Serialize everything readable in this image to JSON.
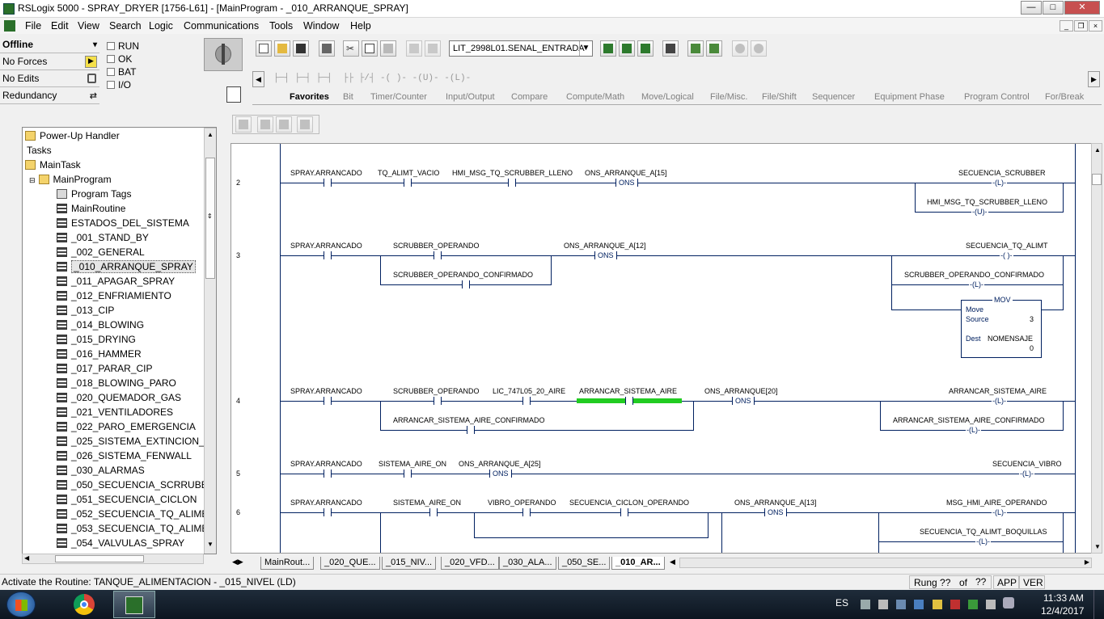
{
  "window": {
    "title": "RSLogix 5000 - SPRAY_DRYER [1756-L61] - [MainProgram - _010_ARRANQUE_SPRAY]"
  },
  "menu": [
    "File",
    "Edit",
    "View",
    "Search",
    "Logic",
    "Communications",
    "Tools",
    "Window",
    "Help"
  ],
  "status_panel": {
    "offline": "Offline",
    "no_forces": "No Forces",
    "no_edits": "No Edits",
    "redundancy": "Redundancy",
    "checks": [
      "RUN",
      "OK",
      "BAT",
      "I/O"
    ]
  },
  "toolbar": {
    "tag_dropdown": "LIT_2998L01.SENAL_ENTRADA"
  },
  "instruction_tabs": [
    "Favorites",
    "Bit",
    "Timer/Counter",
    "Input/Output",
    "Compare",
    "Compute/Math",
    "Move/Logical",
    "File/Misc.",
    "File/Shift",
    "Sequencer",
    "Equipment Phase",
    "Program Control",
    "For/Break"
  ],
  "tree": {
    "top": [
      {
        "label": "Power-Up Handler",
        "icon": "folder-icon"
      },
      {
        "label": "Tasks",
        "icon": ""
      },
      {
        "label": "MainTask",
        "icon": "folder-icon"
      },
      {
        "label": "MainProgram",
        "icon": "program-icon"
      },
      {
        "label": "Program Tags",
        "icon": "tags-icon"
      },
      {
        "label": "MainRoutine",
        "icon": "main-routine-icon"
      }
    ],
    "routines": [
      "ESTADOS_DEL_SISTEMA",
      "_001_STAND_BY",
      "_002_GENERAL",
      "_010_ARRANQUE_SPRAY",
      "_011_APAGAR_SPRAY",
      "_012_ENFRIAMIENTO",
      "_013_CIP",
      "_014_BLOWING",
      "_015_DRYING",
      "_016_HAMMER",
      "_017_PARAR_CIP",
      "_018_BLOWING_PARO",
      "_020_QUEMADOR_GAS",
      "_021_VENTILADORES",
      "_022_PARO_EMERGENCIA",
      "_025_SISTEMA_EXTINCION_FU",
      "_026_SISTEMA_FENWALL",
      "_030_ALARMAS",
      "_050_SECUENCIA_SCRRUBER",
      "_051_SECUENCIA_CICLON",
      "_052_SECUENCIA_TQ_ALIMEN",
      "_053_SECUENCIA_TQ_ALIMEN",
      "_054_VALVULAS_SPRAY"
    ]
  },
  "ladder": {
    "rungs": [
      "2",
      "3",
      "4",
      "5",
      "6"
    ],
    "r2": {
      "c1": "SPRAY.ARRANCADO",
      "c2": "TQ_ALIMT_VACIO",
      "c3": "HMI_MSG_TQ_SCRUBBER_LLENO",
      "c4": "ONS_ARRANQUE_A[15]",
      "ons": "ONS",
      "o1": "SECUENCIA_SCRUBBER",
      "o2": "HMI_MSG_TQ_SCRUBBER_LLENO",
      "coil1": "-(L)-",
      "coil2": "-(U)-"
    },
    "r3": {
      "c1": "SPRAY.ARRANCADO",
      "c2": "SCRUBBER_OPERANDO",
      "c2b": "SCRUBBER_OPERANDO_CONFIRMADO",
      "c3": "ONS_ARRANQUE_A[12]",
      "ons": "ONS",
      "o1": "SECUENCIA_TQ_ALIMT",
      "o2": "SCRUBBER_OPERANDO_CONFIRMADO",
      "coil1": "-( )-",
      "coil2": "-(L)-",
      "mov": {
        "title": "MOV",
        "name": "Move",
        "source": "Source",
        "source_val": "3",
        "dest": "Dest",
        "dest_tag": "NOMENSAJE",
        "dest_val": "0"
      }
    },
    "r4": {
      "c1": "SPRAY.ARRANCADO",
      "c2": "SCRUBBER_OPERANDO",
      "c3": "LIC_747L05_20_AIRE",
      "c4": "ARRANCAR_SISTEMA_AIRE",
      "c2b": "ARRANCAR_SISTEMA_AIRE_CONFIRMADO",
      "c5": "ONS_ARRANQUE[20]",
      "ons": "ONS",
      "o1": "ARRANCAR_SISTEMA_AIRE",
      "o2": "ARRANCAR_SISTEMA_AIRE_CONFIRMADO",
      "coil1": "-(L)-",
      "coil2": "-(L)-"
    },
    "r5": {
      "c1": "SPRAY.ARRANCADO",
      "c2": "SISTEMA_AIRE_ON",
      "c3": "ONS_ARRANQUE_A[25]",
      "ons": "ONS",
      "o1": "SECUENCIA_VIBRO",
      "coil1": "-(L)-"
    },
    "r6": {
      "c1": "SPRAY.ARRANCADO",
      "c2": "SISTEMA_AIRE_ON",
      "c3": "VIBRO_OPERANDO",
      "c4": "SECUENCIA_CICLON_OPERANDO",
      "c5": "ONS_ARRANQUE_A[13]",
      "ons": "ONS",
      "o1": "MSG_HMI_AIRE_OPERANDO",
      "o2": "SECUENCIA_TQ_ALIMT_BOQUILLAS",
      "coil1": "-(L)-",
      "coil2": "-(L)-"
    }
  },
  "bottom_tabs": [
    "MainRout...",
    "_020_QUE...",
    "_015_NIV...",
    "_020_VFD...",
    "_030_ALA...",
    "_050_SE...",
    "_010_AR..."
  ],
  "statusbar": {
    "message": "Activate the Routine: TANQUE_ALIMENTACION - _015_NIVEL (LD)",
    "rung": "Rung ??",
    "of": "of",
    "total": "??",
    "app": "APP",
    "ver": "VER"
  },
  "taskbar": {
    "lang": "ES",
    "time": "11:33 AM",
    "date": "12/4/2017"
  },
  "colors": {
    "wire": "#002060",
    "highlight": "#22cc22"
  }
}
